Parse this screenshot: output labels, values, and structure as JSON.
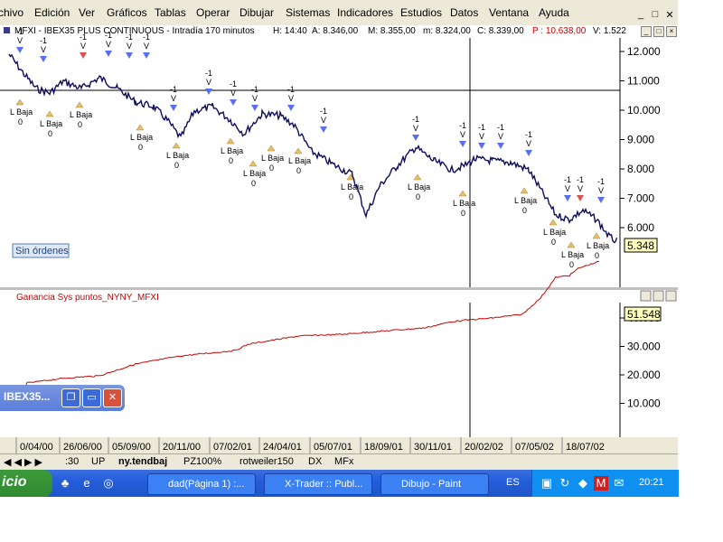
{
  "menu": [
    "chivo",
    "Edición",
    "Ver",
    "Gráficos",
    "Tablas",
    "Operar",
    "Dibujar",
    "Sistemas",
    "Indicadores",
    "Estudios",
    "Datos",
    "Ventana",
    "Ayuda"
  ],
  "mdi_controls": [
    "_",
    "□",
    "✕"
  ],
  "price_window": {
    "title": "MFXI - IBEX35 PLUS CONTINUOUS - Intradía 170 minutos",
    "time": "H: 14:40",
    "open": "A: 8.346,00",
    "high": "M: 8.355,00",
    "low": "m: 8.324,00",
    "close": "C: 8.339,00",
    "profit": "P : 10.638,00",
    "volume": "V: 1.522",
    "last_value": "5.348",
    "orders_label": "Sin órdenes",
    "y_ticks": [
      "12.000",
      "11.000",
      "10.000",
      "9.000",
      "8.000",
      "7.000",
      "6.000"
    ],
    "signal_entry_label": "L Baja",
    "signal_zero": "0",
    "signal_exit_label": "-1",
    "signal_exit_mark": "V"
  },
  "indicator_window": {
    "title": "Ganancia Sys puntos_NYNY_MFXI",
    "last_value": "51.548",
    "y_ticks": [
      "40.000",
      "30.000",
      "20.000",
      "10.000"
    ]
  },
  "x_axis_dates": [
    "0/04/00",
    "26/06/00",
    "05/09/00",
    "20/11/00",
    "07/02/01",
    "24/04/01",
    "05/07/01",
    "18/09/01",
    "30/11/01",
    "20/02/02",
    "07/05/02",
    "18/07/02"
  ],
  "floating_window": {
    "title": "IBEX35...",
    "buttons": [
      "❐",
      "▭",
      "✕"
    ]
  },
  "tabs": [
    ":30",
    "UP",
    "ny.tendbaj",
    "PZ100%",
    "rotweiler150",
    "DX",
    "MFx"
  ],
  "taskbar": {
    "start_label": "icio",
    "tasks": [
      "dad(Página 1) :...",
      "X-Trader :: Publ...",
      "Dibujo - Paint"
    ],
    "language": "ES",
    "clock": "20:21"
  },
  "colors": {
    "price_line": "#0d0d5c",
    "indicator_line": "#cc0000",
    "down_arrow": "#5a6ef0",
    "red_arrow": "#e05050",
    "up_arrow": "#e8c060",
    "title_red": "#cc0000"
  }
}
